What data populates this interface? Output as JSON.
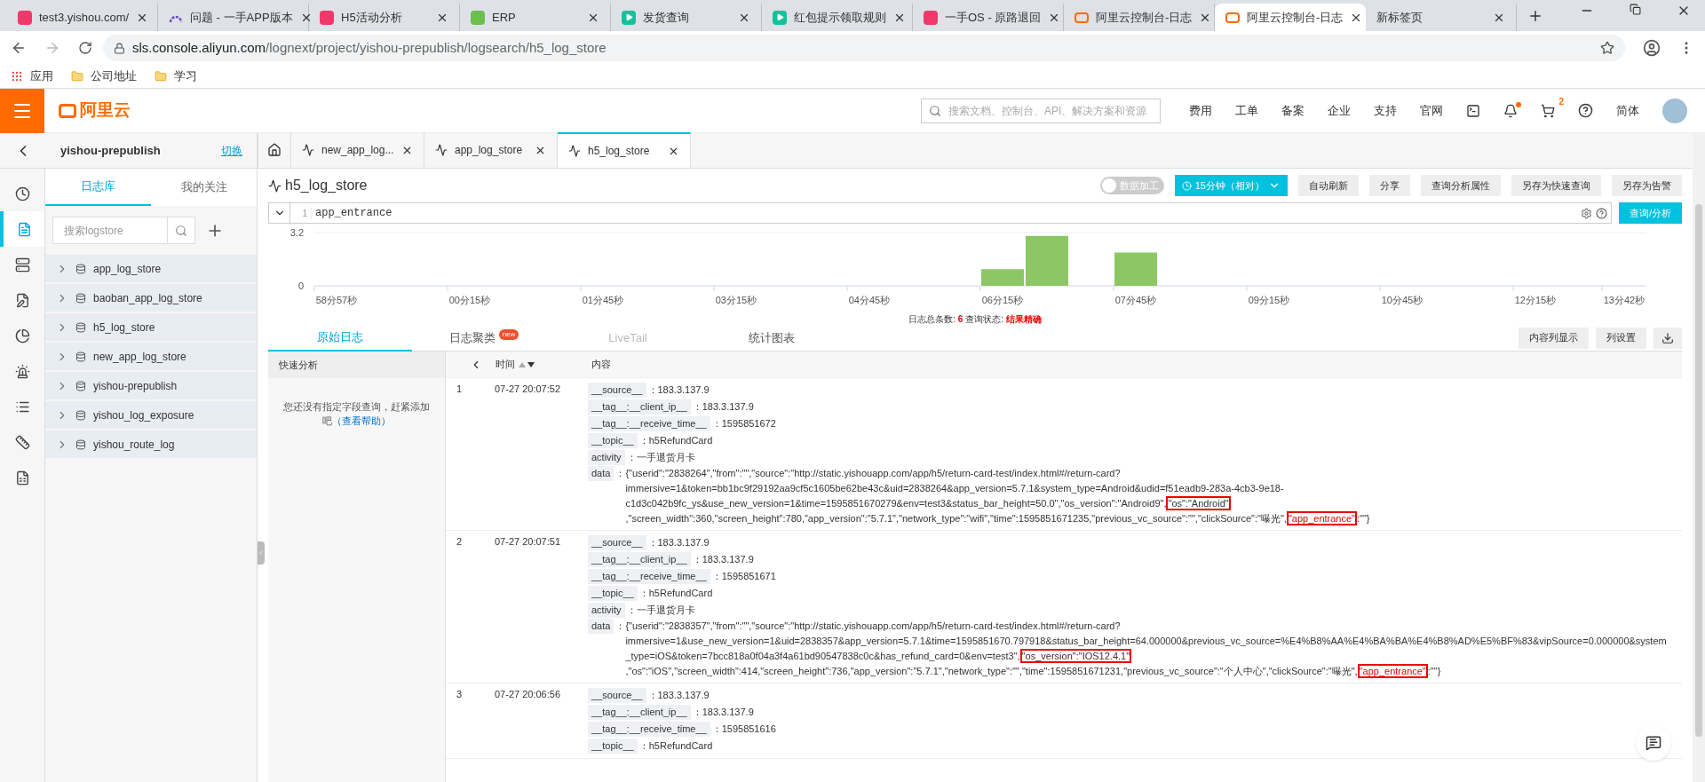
{
  "browser": {
    "tabs": [
      {
        "title": "test3.yishou.com/",
        "kind": "app",
        "selected": false
      },
      {
        "title": "问题 - 一手APP版本",
        "kind": "arc",
        "selected": false
      },
      {
        "title": "H5活动分析",
        "kind": "app",
        "selected": false
      },
      {
        "title": "ERP",
        "kind": "leaf",
        "selected": false
      },
      {
        "title": "发货查询",
        "kind": "play",
        "selected": false
      },
      {
        "title": "红包提示领取规则",
        "kind": "play",
        "selected": false
      },
      {
        "title": "一手OS - 原路退回",
        "kind": "app",
        "selected": false
      },
      {
        "title": "阿里云控制台-日志",
        "kind": "aliyun",
        "selected": false
      },
      {
        "title": "阿里云控制台-日志",
        "kind": "aliyun",
        "selected": true
      },
      {
        "title": "新标签页",
        "kind": "blank",
        "selected": false
      }
    ],
    "url_host": "sls.console.aliyun.com",
    "url_path": "/lognext/project/yishou-prepublish/logsearch/h5_log_store",
    "bookmarks": [
      {
        "label": "应用",
        "kind": "apps"
      },
      {
        "label": "公司地址",
        "kind": "folder"
      },
      {
        "label": "学习",
        "kind": "folder"
      }
    ]
  },
  "console": {
    "logo": "阿里云",
    "search_placeholder": "搜索文档、控制台、API、解决方案和资源",
    "links": [
      "费用",
      "工单",
      "备案",
      "企业",
      "支持",
      "官网"
    ],
    "cart_count": "2",
    "language": "简体"
  },
  "project": {
    "name": "yishou-prepublish",
    "switch": "切换"
  },
  "rail": [
    {
      "selected": false
    },
    {
      "selected": true
    },
    {
      "selected": false
    },
    {
      "selected": false
    },
    {
      "selected": false
    },
    {
      "selected": false
    },
    {
      "selected": false
    },
    {
      "selected": false
    },
    {
      "selected": false
    }
  ],
  "sidebar": {
    "tabs": [
      {
        "label": "日志库",
        "selected": true
      },
      {
        "label": "我的关注",
        "selected": false
      }
    ],
    "search_placeholder": "搜索logstore",
    "items": [
      "app_log_store",
      "baoban_app_log_store",
      "h5_log_store",
      "new_app_log_store",
      "yishou-prepublish",
      "yishou_log_exposure",
      "yishou_route_log"
    ]
  },
  "page_tabs": [
    {
      "label": "new_app_log...",
      "selected": false
    },
    {
      "label": "app_log_store",
      "selected": false
    },
    {
      "label": "h5_log_store",
      "selected": true
    }
  ],
  "logstore": {
    "title": "h5_log_store",
    "data_processing": {
      "label": "数据加工",
      "on": false
    },
    "time_range": "15分钟（相对）",
    "buttons": [
      "自动刷新",
      "分享",
      "查询分析属性",
      "另存为快速查询",
      "另存为告警"
    ],
    "query": {
      "line": "1",
      "value": "app_entrance"
    },
    "search_button": "查询/分析",
    "histogram": {
      "chart_data": {
        "type": "bar",
        "categories": [
          "58分57秒",
          null,
          null,
          "00分15秒",
          null,
          null,
          "01分45秒",
          null,
          null,
          "03分15秒",
          null,
          null,
          "04分45秒",
          null,
          null,
          "06分15秒",
          null,
          null,
          "07分45秒",
          null,
          null,
          "09分15秒",
          null,
          null,
          "10分45秒",
          null,
          null,
          "12分15秒",
          null,
          "13分42秒"
        ],
        "values": [
          0,
          0,
          0,
          0,
          0,
          0,
          0,
          0,
          0,
          0,
          0,
          0,
          0,
          0,
          0,
          1,
          3,
          0,
          2,
          0,
          0,
          0,
          0,
          0,
          0,
          0,
          0,
          0,
          0,
          0
        ],
        "ylim": [
          0,
          3.2
        ],
        "yticks": [
          0,
          3.2
        ]
      }
    },
    "summary": {
      "count_label": "日志总条数:",
      "count": "6",
      "status_label": "查询状态:",
      "status": "结果精确"
    },
    "result_tabs": [
      {
        "label": "原始日志",
        "selected": true,
        "disabled": false
      },
      {
        "label": "日志聚类",
        "selected": false,
        "disabled": false,
        "badge": "new"
      },
      {
        "label": "LiveTail",
        "selected": false,
        "disabled": true
      },
      {
        "label": "统计图表",
        "selected": false,
        "disabled": false
      }
    ],
    "result_buttons": [
      "内容列显示",
      "列设置"
    ],
    "quick_analysis": {
      "title": "快速分析",
      "message": "您还没有指定字段查询，赶紧添加吧",
      "help_link": "（查看帮助）"
    },
    "columns": {
      "time": "时间",
      "content": "内容"
    },
    "rows": [
      {
        "index": "1",
        "time": "07-27 20:07:52",
        "fields": [
          {
            "key": "__source__",
            "sep": "：",
            "value": "183.3.137.9"
          },
          {
            "key": "__tag__:__client_ip__",
            "sep": "：",
            "value": "183.3.137.9"
          },
          {
            "key": "__tag__:__receive_time__",
            "sep": "：",
            "value": "1595851672"
          },
          {
            "key": "__topic__",
            "sep": "：",
            "value": "h5RefundCard"
          },
          {
            "key": "activity",
            "sep": "：",
            "value": "一手退货月卡"
          }
        ],
        "data": {
          "key": "data",
          "sep": "：",
          "segments": [
            {
              "text": "{\"userid\":\"2838264\",\"from\":\"\",\"source\":\"http://static.yishouapp.com/app/h5/return-card-test/index.html#/return-card?immersive=1&token=bb1bc9f29192aa9cf5c1605be62be43c&uid=2838264&app_version=5.7.1&system_type=Android&udid=f51eadb9-283a-4cb3-9e18-c1d3c042b9fc_ys&use_new_version=1&time=1595851670279&env=test3&status_bar_height=50.0\",\"os_version\":\"Android9\",",
              "boxed": false,
              "red": false
            },
            {
              "text": "\"os\":\"Android\"",
              "boxed": true,
              "red": false
            },
            {
              "text": ",\"screen_width\":360,\"screen_height\":780,\"app_version\":\"5.7.1\",\"network_type\":\"wifi\",\"time\":1595851671235,\"previous_vc_source\":\"\",\"clickSource\":\"曝光\",",
              "boxed": false,
              "red": false
            },
            {
              "text": "\"app_entrance\"",
              "boxed": true,
              "red": true
            },
            {
              "text": ":\"\"}",
              "boxed": false,
              "red": false
            }
          ]
        }
      },
      {
        "index": "2",
        "time": "07-27 20:07:51",
        "fields": [
          {
            "key": "__source__",
            "sep": "：",
            "value": "183.3.137.9"
          },
          {
            "key": "__tag__:__client_ip__",
            "sep": "：",
            "value": "183.3.137.9"
          },
          {
            "key": "__tag__:__receive_time__",
            "sep": "：",
            "value": "1595851671"
          },
          {
            "key": "__topic__",
            "sep": "：",
            "value": "h5RefundCard"
          },
          {
            "key": "activity",
            "sep": "：",
            "value": "一手退货月卡"
          }
        ],
        "data": {
          "key": "data",
          "sep": "：",
          "segments": [
            {
              "text": "{\"userid\":\"2838357\",\"from\":\"\",\"source\":\"http://static.yishouapp.com/app/h5/return-card-test/index.html#/return-card?immersive=1&use_new_version=1&uid=2838357&app_version=5.7.1&time=1595851670.797918&status_bar_height=64.000000&previous_vc_source=%E4%B8%AA%E4%BA%BA%E4%B8%AD%E5%BF%83&vipSource=0.000000&system_type=iOS&token=7bcc818a0f04a3f4a61bd90547838c0c&has_refund_card=0&env=test3\",",
              "boxed": false,
              "red": false
            },
            {
              "text": "\"os_version\":\"IOS12.4.1\"",
              "boxed": true,
              "red": false
            },
            {
              "text": ",\"os\":\"iOS\",\"screen_width\":414,\"screen_height\":736,\"app_version\":\"5.7.1\",\"network_type\":\"\",\"time\":1595851671231,\"previous_vc_source\":\"个人中心\",\"clickSource\":\"曝光\",",
              "boxed": false,
              "red": false
            },
            {
              "text": "\"app_entrance\"",
              "boxed": true,
              "red": true
            },
            {
              "text": ":\"\"}",
              "boxed": false,
              "red": false
            }
          ]
        }
      },
      {
        "index": "3",
        "time": "07-27 20:06:56",
        "fields": [
          {
            "key": "__source__",
            "sep": "：",
            "value": "183.3.137.9"
          },
          {
            "key": "__tag__:__client_ip__",
            "sep": "：",
            "value": "183.3.137.9"
          },
          {
            "key": "__tag__:__receive_time__",
            "sep": "：",
            "value": "1595851616"
          },
          {
            "key": "__topic__",
            "sep": "：",
            "value": "h5RefundCard"
          }
        ]
      }
    ]
  }
}
